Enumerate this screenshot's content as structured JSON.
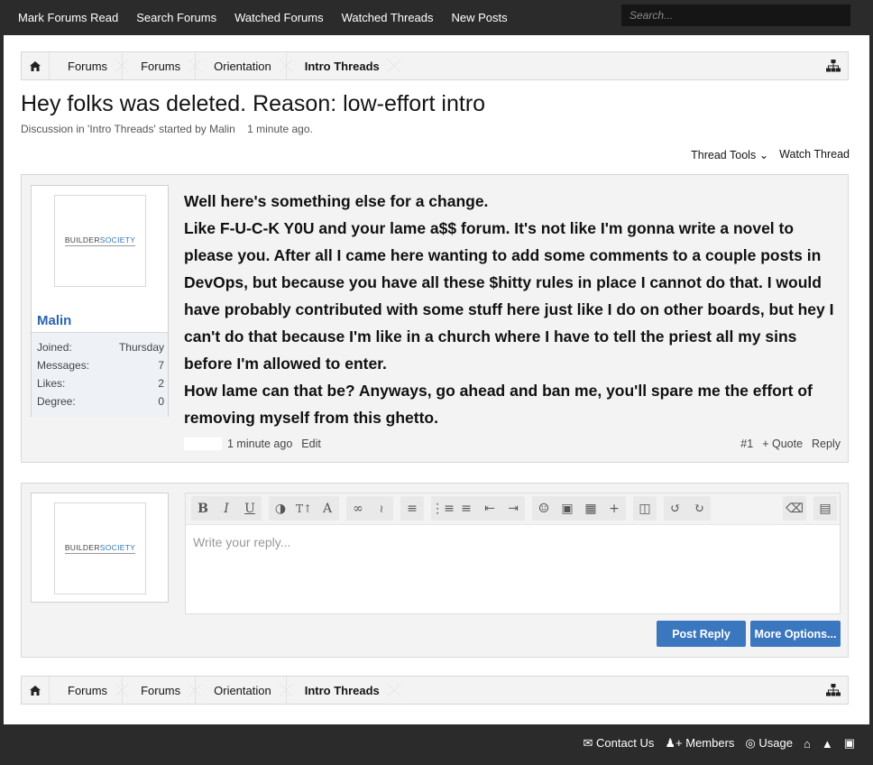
{
  "topnav": {
    "links": [
      "Mark Forums Read",
      "Search Forums",
      "Watched Forums",
      "Watched Threads",
      "New Posts"
    ],
    "search_placeholder": "Search..."
  },
  "breadcrumb": {
    "items": [
      "Forums",
      "Forums",
      "Orientation",
      "Intro Threads"
    ]
  },
  "thread": {
    "title": "Hey folks was deleted. Reason: low-effort intro",
    "meta": "Discussion in 'Intro Threads' started by Malin    1 minute ago.",
    "tools_label": "Thread Tools",
    "watch_label": "Watch Thread"
  },
  "post": {
    "logo_left": "BUILDER",
    "logo_right": "SOCIETY",
    "username": "Malin",
    "stats": [
      {
        "label": "Joined:",
        "value": "Thursday"
      },
      {
        "label": "Messages:",
        "value": "7"
      },
      {
        "label": "Likes:",
        "value": "2"
      },
      {
        "label": "Degree:",
        "value": "0"
      }
    ],
    "lines": [
      "Well here's something else for a change.",
      "Like F-U-C-K Y0U and your lame a$$ forum. It's not like I'm gonna write a novel to please you. After all I came here wanting to add some comments to a couple posts in DevOps, but because you have all these $hitty rules in place I cannot do that. I would have probably contributed with some stuff here just like I do on other boards, but hey I can't do that because I'm like in a church where I have to tell the priest all my sins before I'm allowed to enter.",
      "How lame can that be? Anyways, go ahead and ban me, you'll spare me the effort of removing myself from this ghetto."
    ],
    "time": "1 minute ago",
    "edit": "Edit",
    "number": "#1",
    "quote": "+ Quote",
    "reply": "Reply"
  },
  "reply": {
    "placeholder": "Write your reply...",
    "post_button": "Post Reply",
    "more_button": "More Options..."
  },
  "footer": {
    "links": [
      "Contact Us",
      "Members",
      "Usage"
    ]
  },
  "colors": {
    "accent": "#3b77be",
    "username": "#2b64ac",
    "bar": "#2b2b2b"
  }
}
